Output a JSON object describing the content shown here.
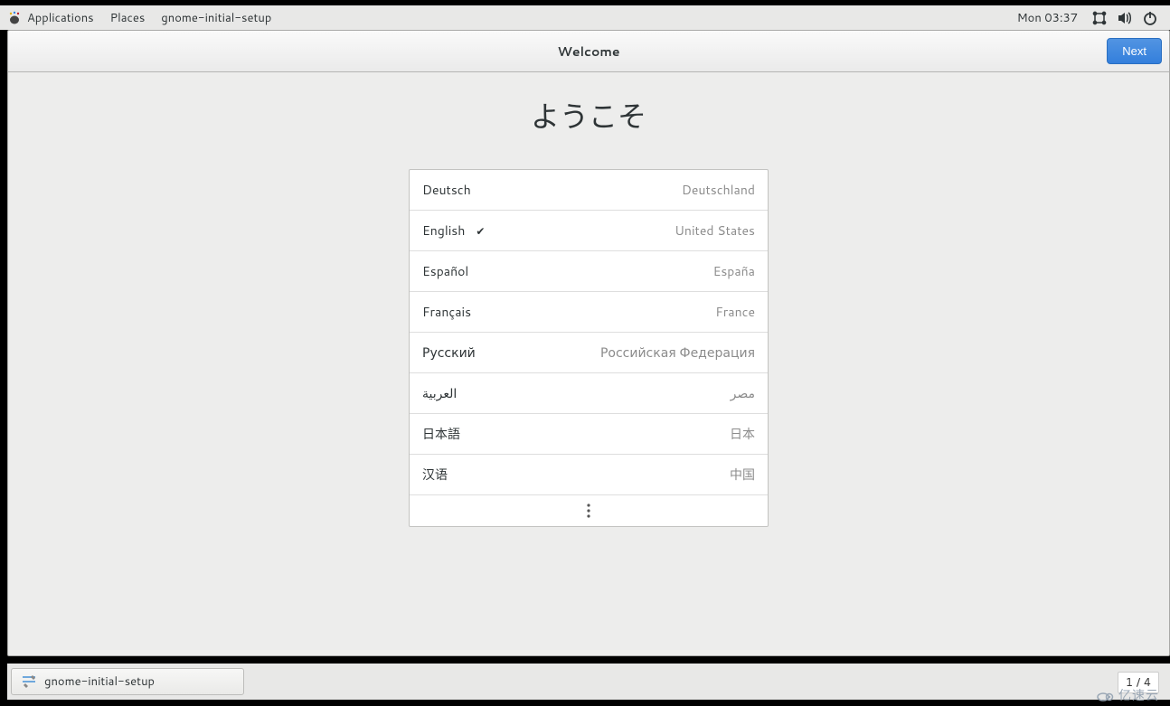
{
  "top_panel": {
    "applications": "Applications",
    "places": "Places",
    "app_name": "gnome-initial-setup",
    "clock": "Mon 03:37"
  },
  "header": {
    "title": "Welcome",
    "next": "Next"
  },
  "hero": "ようこそ",
  "languages": [
    {
      "name": "Deutsch",
      "country": "Deutschland",
      "selected": false
    },
    {
      "name": "English",
      "country": "United States",
      "selected": true
    },
    {
      "name": "Español",
      "country": "España",
      "selected": false
    },
    {
      "name": "Français",
      "country": "France",
      "selected": false
    },
    {
      "name": "Русский",
      "country": "Российская Федерация",
      "selected": false
    },
    {
      "name": "العربية",
      "country": "مصر",
      "selected": false
    },
    {
      "name": "日本語",
      "country": "日本",
      "selected": false
    },
    {
      "name": "汉语",
      "country": "中国",
      "selected": false
    }
  ],
  "taskbar": {
    "app": "gnome-initial-setup"
  },
  "page_counter": "1 / 4",
  "watermark": "亿速云"
}
